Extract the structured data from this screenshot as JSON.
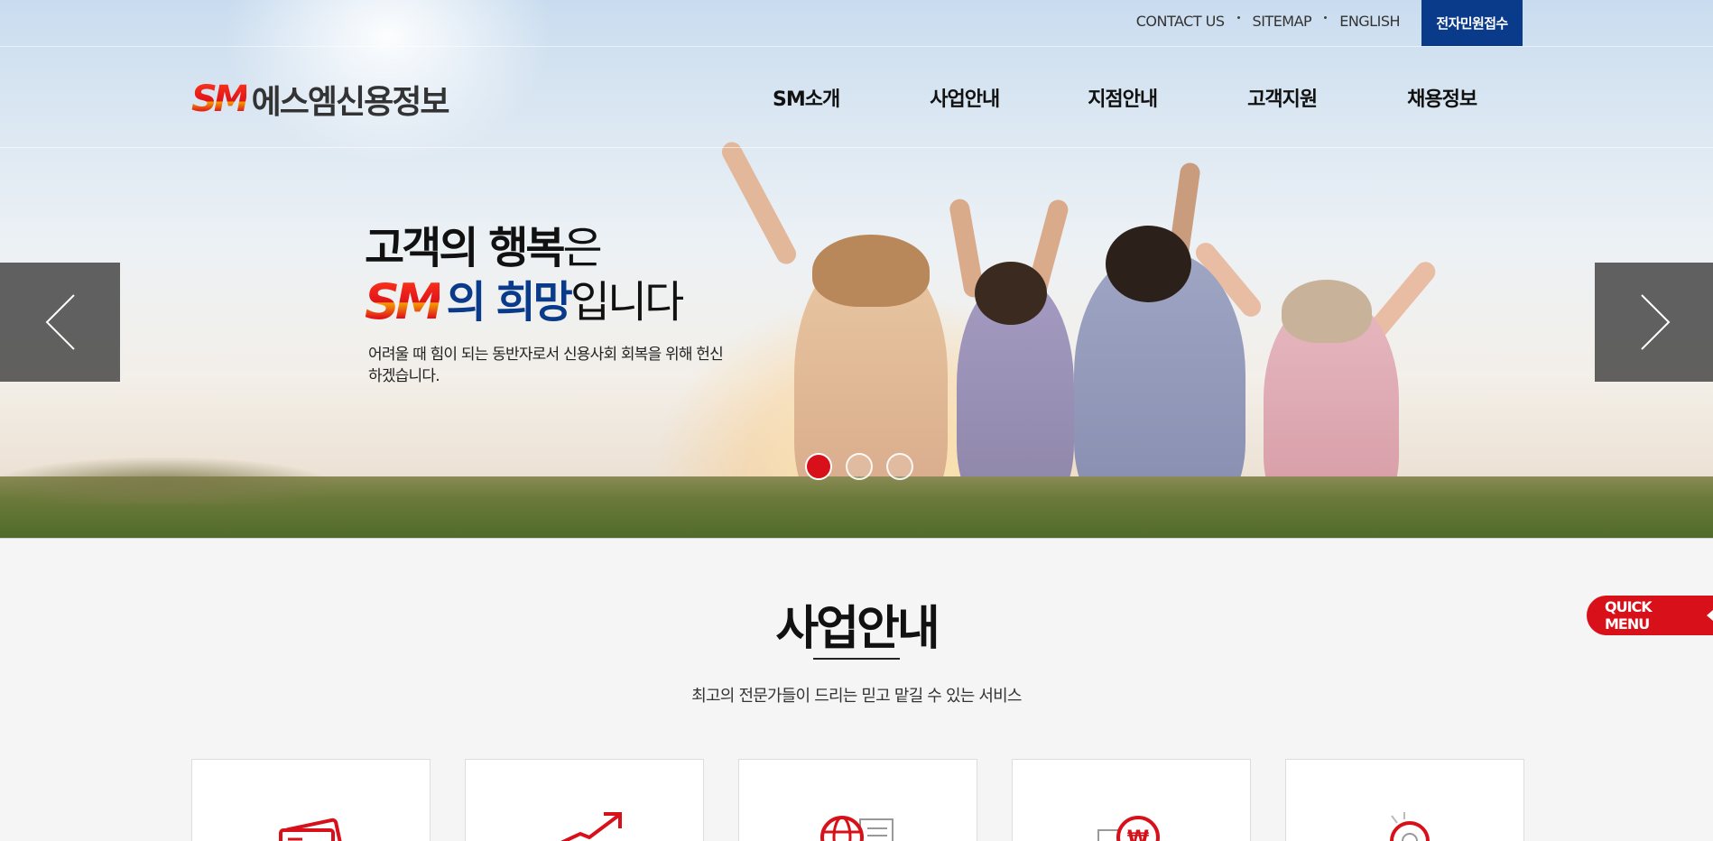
{
  "topbar": {
    "links": [
      "CONTACT US",
      "SITEMAP",
      "ENGLISH"
    ],
    "civil_button": "전자민원접수"
  },
  "logo": {
    "mark": "SM",
    "name": "에스엠신용정보"
  },
  "nav": [
    "SM소개",
    "사업안내",
    "지점안내",
    "고객지원",
    "채용정보"
  ],
  "hero": {
    "line1_strong": "고객의 행복",
    "line1_light": "은",
    "line2_mark": "SM",
    "line2_blue": "의 희망",
    "line2_rest": "입니다",
    "subtext": "어려울 때 힘이 되는 동반자로서 신용사회 회복을 위해 헌신하겠습니다.",
    "slide_count": 3,
    "active_slide": 1
  },
  "section": {
    "title": "사업안내",
    "subtitle": "최고의 전문가들이 드리는 믿고 맡길 수 있는 서비스",
    "cards": [
      {
        "icon": "card-payment-icon"
      },
      {
        "icon": "growth-arrow-icon"
      },
      {
        "icon": "globe-document-icon"
      },
      {
        "icon": "won-coin-icon"
      },
      {
        "icon": "alert-search-icon"
      }
    ]
  },
  "quick_menu": {
    "label": "QUICK MENU"
  },
  "colors": {
    "brand_red": "#d8101a",
    "brand_blue": "#0a3a8a"
  }
}
